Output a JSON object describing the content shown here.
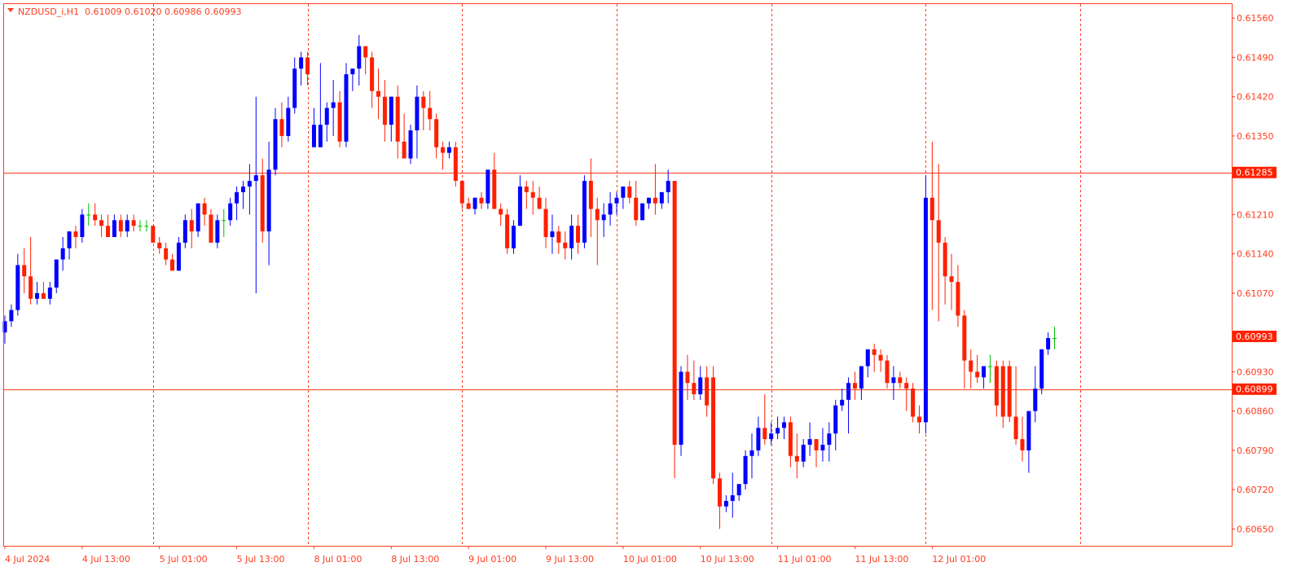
{
  "header": {
    "symbol": "NZDUSD_i,H1",
    "ohlc": "0.61009 0.61020 0.60986 0.60993"
  },
  "colors": {
    "background": "#ffffff",
    "frame": "#ff3c1f",
    "text": "#ff3c1f",
    "bull": "#0000ff",
    "bear": "#ff2000",
    "doji": "#00c000",
    "grid": "#ff3c1f",
    "hline": "#ff3c1f",
    "price_label_bg": "#ff2000",
    "price_label_text": "#ffffff"
  },
  "chart_data": {
    "type": "candlestick",
    "symbol": "NZDUSD_i",
    "timeframe": "H1",
    "ylim": [
      0.6062,
      0.61585
    ],
    "y_ticks": [
      "0.61560",
      "0.61490",
      "0.61420",
      "0.61350",
      "0.61285",
      "0.61210",
      "0.61140",
      "0.61070",
      "0.60993",
      "0.60930",
      "0.60899",
      "0.60860",
      "0.60790",
      "0.60720",
      "0.60650"
    ],
    "x_labels": [
      "4 Jul 2024",
      "4 Jul 13:00",
      "5 Jul 01:00",
      "5 Jul 13:00",
      "8 Jul 01:00",
      "8 Jul 13:00",
      "9 Jul 01:00",
      "9 Jul 13:00",
      "10 Jul 01:00",
      "10 Jul 13:00",
      "11 Jul 01:00",
      "11 Jul 13:00",
      "12 Jul 01:00"
    ],
    "x_label_index": [
      0,
      12,
      24,
      36,
      48,
      60,
      72,
      84,
      96,
      108,
      120,
      132,
      144
    ],
    "vertical_grid_index": [
      23,
      47,
      71,
      95,
      119,
      143,
      167
    ],
    "horizontal_lines": [
      {
        "value": 0.61285,
        "label": "0.61285"
      },
      {
        "value": 0.60899,
        "label": "0.60899"
      }
    ],
    "current_price": {
      "value": 0.60993,
      "label": "0.60993"
    },
    "candles": [
      [
        0.61,
        0.6103,
        0.6098,
        0.6102
      ],
      [
        0.6102,
        0.6105,
        0.6101,
        0.6104
      ],
      [
        0.6104,
        0.6114,
        0.6103,
        0.6112
      ],
      [
        0.6112,
        0.6115,
        0.6107,
        0.611
      ],
      [
        0.611,
        0.6117,
        0.6105,
        0.6106
      ],
      [
        0.6106,
        0.6109,
        0.6105,
        0.6107
      ],
      [
        0.6107,
        0.6109,
        0.6106,
        0.6106
      ],
      [
        0.6106,
        0.6109,
        0.6105,
        0.6108
      ],
      [
        0.6108,
        0.6113,
        0.6107,
        0.6113
      ],
      [
        0.6113,
        0.6117,
        0.6111,
        0.6115
      ],
      [
        0.6115,
        0.6118,
        0.6113,
        0.6118
      ],
      [
        0.6118,
        0.6119,
        0.6115,
        0.6117
      ],
      [
        0.6117,
        0.6122,
        0.6116,
        0.6121
      ],
      [
        0.6121,
        0.6123,
        0.6119,
        0.6121
      ],
      [
        0.6121,
        0.6123,
        0.6119,
        0.612
      ],
      [
        0.612,
        0.6121,
        0.6117,
        0.6119
      ],
      [
        0.6119,
        0.6121,
        0.6117,
        0.6117
      ],
      [
        0.6117,
        0.6121,
        0.6117,
        0.612
      ],
      [
        0.612,
        0.6121,
        0.6117,
        0.6118
      ],
      [
        0.6118,
        0.6121,
        0.6117,
        0.612
      ],
      [
        0.612,
        0.6121,
        0.6118,
        0.6119
      ],
      [
        0.6119,
        0.612,
        0.6118,
        0.6119
      ],
      [
        0.6119,
        0.612,
        0.6118,
        0.6119
      ],
      [
        0.6119,
        0.6119,
        0.6116,
        0.6116
      ],
      [
        0.6116,
        0.6117,
        0.6114,
        0.6115
      ],
      [
        0.6115,
        0.6116,
        0.6112,
        0.6113
      ],
      [
        0.6113,
        0.6114,
        0.6111,
        0.6111
      ],
      [
        0.6111,
        0.6117,
        0.6111,
        0.6116
      ],
      [
        0.6116,
        0.6121,
        0.6115,
        0.612
      ],
      [
        0.612,
        0.6122,
        0.6115,
        0.6118
      ],
      [
        0.6118,
        0.6123,
        0.6117,
        0.6123
      ],
      [
        0.6123,
        0.6124,
        0.6119,
        0.6121
      ],
      [
        0.6121,
        0.6122,
        0.6116,
        0.6116
      ],
      [
        0.6116,
        0.6121,
        0.6115,
        0.612
      ],
      [
        0.612,
        0.6122,
        0.6117,
        0.612
      ],
      [
        0.612,
        0.6124,
        0.6119,
        0.6123
      ],
      [
        0.6123,
        0.6126,
        0.612,
        0.6125
      ],
      [
        0.6125,
        0.6127,
        0.6122,
        0.6126
      ],
      [
        0.6126,
        0.613,
        0.6121,
        0.6127
      ],
      [
        0.6127,
        0.6142,
        0.6107,
        0.6128
      ],
      [
        0.6128,
        0.6131,
        0.6116,
        0.6118
      ],
      [
        0.6118,
        0.6134,
        0.6112,
        0.6129
      ],
      [
        0.6129,
        0.614,
        0.6128,
        0.6138
      ],
      [
        0.6138,
        0.6141,
        0.6133,
        0.6135
      ],
      [
        0.6135,
        0.6142,
        0.6134,
        0.614
      ],
      [
        0.614,
        0.6149,
        0.6139,
        0.6147
      ],
      [
        0.6147,
        0.615,
        0.6144,
        0.6149
      ],
      [
        0.6149,
        0.615,
        0.6144,
        0.6146
      ],
      [
        0.6133,
        0.614,
        0.6133,
        0.6137
      ],
      [
        0.6133,
        0.6148,
        0.6133,
        0.6137
      ],
      [
        0.6137,
        0.6141,
        0.6134,
        0.614
      ],
      [
        0.614,
        0.6145,
        0.6135,
        0.6141
      ],
      [
        0.6141,
        0.6143,
        0.6133,
        0.6134
      ],
      [
        0.6134,
        0.6148,
        0.6133,
        0.6146
      ],
      [
        0.6146,
        0.6147,
        0.6143,
        0.6147
      ],
      [
        0.6147,
        0.6153,
        0.6144,
        0.6151
      ],
      [
        0.6151,
        0.6151,
        0.6146,
        0.6149
      ],
      [
        0.6149,
        0.615,
        0.614,
        0.6143
      ],
      [
        0.6143,
        0.6147,
        0.6138,
        0.6142
      ],
      [
        0.6142,
        0.6145,
        0.6134,
        0.6137
      ],
      [
        0.6137,
        0.6142,
        0.6134,
        0.6142
      ],
      [
        0.6142,
        0.6144,
        0.6131,
        0.6134
      ],
      [
        0.6134,
        0.6139,
        0.6131,
        0.6131
      ],
      [
        0.6131,
        0.6137,
        0.613,
        0.6136
      ],
      [
        0.6136,
        0.6144,
        0.6131,
        0.6142
      ],
      [
        0.6142,
        0.6143,
        0.6136,
        0.614
      ],
      [
        0.614,
        0.6143,
        0.6136,
        0.6138
      ],
      [
        0.6138,
        0.6139,
        0.6131,
        0.6133
      ],
      [
        0.6133,
        0.6134,
        0.6129,
        0.6132
      ],
      [
        0.6132,
        0.6134,
        0.6131,
        0.6133
      ],
      [
        0.6133,
        0.6134,
        0.6126,
        0.6127
      ],
      [
        0.6127,
        0.6127,
        0.6122,
        0.6123
      ],
      [
        0.6123,
        0.6124,
        0.6122,
        0.6122
      ],
      [
        0.6122,
        0.6124,
        0.6121,
        0.6124
      ],
      [
        0.6124,
        0.6125,
        0.6122,
        0.6123
      ],
      [
        0.6123,
        0.6129,
        0.6122,
        0.6129
      ],
      [
        0.6129,
        0.6132,
        0.6125,
        0.6122
      ],
      [
        0.6122,
        0.6123,
        0.6119,
        0.6121
      ],
      [
        0.6121,
        0.6122,
        0.6114,
        0.6115
      ],
      [
        0.6115,
        0.612,
        0.6114,
        0.6119
      ],
      [
        0.6119,
        0.6128,
        0.6119,
        0.6126
      ],
      [
        0.6126,
        0.6127,
        0.6122,
        0.6125
      ],
      [
        0.6125,
        0.6127,
        0.6121,
        0.6124
      ],
      [
        0.6124,
        0.6126,
        0.6122,
        0.6122
      ],
      [
        0.6122,
        0.6124,
        0.6115,
        0.6117
      ],
      [
        0.6117,
        0.6121,
        0.6114,
        0.6118
      ],
      [
        0.6118,
        0.6119,
        0.6114,
        0.6116
      ],
      [
        0.6116,
        0.6118,
        0.6113,
        0.6115
      ],
      [
        0.6115,
        0.6121,
        0.6113,
        0.6119
      ],
      [
        0.6119,
        0.6121,
        0.6114,
        0.6116
      ],
      [
        0.6116,
        0.6128,
        0.6115,
        0.6127
      ],
      [
        0.6127,
        0.6131,
        0.6117,
        0.6122
      ],
      [
        0.6122,
        0.6124,
        0.6112,
        0.612
      ],
      [
        0.612,
        0.6123,
        0.6117,
        0.6121
      ],
      [
        0.6121,
        0.6125,
        0.6119,
        0.6123
      ],
      [
        0.6123,
        0.6125,
        0.6121,
        0.6124
      ],
      [
        0.6124,
        0.6126,
        0.6122,
        0.6126
      ],
      [
        0.6126,
        0.6127,
        0.6123,
        0.6124
      ],
      [
        0.6124,
        0.6127,
        0.6119,
        0.612
      ],
      [
        0.612,
        0.6123,
        0.612,
        0.6123
      ],
      [
        0.6123,
        0.6124,
        0.6122,
        0.6124
      ],
      [
        0.6124,
        0.613,
        0.6121,
        0.6123
      ],
      [
        0.6123,
        0.6125,
        0.6122,
        0.6125
      ],
      [
        0.6125,
        0.6129,
        0.6123,
        0.6127
      ],
      [
        0.6127,
        0.6127,
        0.6074,
        0.608
      ],
      [
        0.608,
        0.6094,
        0.6078,
        0.6093
      ],
      [
        0.6093,
        0.6096,
        0.6088,
        0.6091
      ],
      [
        0.6091,
        0.6095,
        0.6088,
        0.6089
      ],
      [
        0.6089,
        0.6094,
        0.6088,
        0.6092
      ],
      [
        0.6092,
        0.6094,
        0.6085,
        0.6087
      ],
      [
        0.6092,
        0.6094,
        0.6073,
        0.6074
      ],
      [
        0.6074,
        0.6075,
        0.6065,
        0.6069
      ],
      [
        0.6069,
        0.6071,
        0.6068,
        0.607
      ],
      [
        0.607,
        0.6075,
        0.6067,
        0.6071
      ],
      [
        0.6071,
        0.6073,
        0.607,
        0.6073
      ],
      [
        0.6073,
        0.6079,
        0.6072,
        0.6078
      ],
      [
        0.6078,
        0.6082,
        0.6074,
        0.6079
      ],
      [
        0.6079,
        0.6085,
        0.6078,
        0.6083
      ],
      [
        0.6083,
        0.6089,
        0.608,
        0.6081
      ],
      [
        0.6081,
        0.6084,
        0.608,
        0.6082
      ],
      [
        0.6082,
        0.6085,
        0.6081,
        0.6083
      ],
      [
        0.6083,
        0.6085,
        0.6081,
        0.6084
      ],
      [
        0.6084,
        0.6085,
        0.6076,
        0.6078
      ],
      [
        0.6078,
        0.6082,
        0.6074,
        0.6077
      ],
      [
        0.6077,
        0.6081,
        0.6076,
        0.608
      ],
      [
        0.608,
        0.6084,
        0.6078,
        0.6081
      ],
      [
        0.6081,
        0.6081,
        0.6076,
        0.6079
      ],
      [
        0.6079,
        0.6083,
        0.6077,
        0.608
      ],
      [
        0.608,
        0.6084,
        0.6077,
        0.6082
      ],
      [
        0.6082,
        0.6088,
        0.6079,
        0.6087
      ],
      [
        0.6087,
        0.609,
        0.6086,
        0.6088
      ],
      [
        0.6088,
        0.6092,
        0.6082,
        0.6091
      ],
      [
        0.6091,
        0.6093,
        0.6088,
        0.609
      ],
      [
        0.609,
        0.6094,
        0.6088,
        0.6094
      ],
      [
        0.6094,
        0.6097,
        0.6092,
        0.6097
      ],
      [
        0.6097,
        0.6098,
        0.6093,
        0.6096
      ],
      [
        0.6096,
        0.6097,
        0.6093,
        0.6095
      ],
      [
        0.6095,
        0.6096,
        0.609,
        0.6091
      ],
      [
        0.6091,
        0.6094,
        0.6088,
        0.6092
      ],
      [
        0.6092,
        0.6093,
        0.609,
        0.6091
      ],
      [
        0.6091,
        0.6092,
        0.6086,
        0.609
      ],
      [
        0.609,
        0.6091,
        0.6084,
        0.6085
      ],
      [
        0.6085,
        0.6087,
        0.6082,
        0.6084
      ],
      [
        0.6084,
        0.6128,
        0.6082,
        0.6124
      ],
      [
        0.6124,
        0.6134,
        0.6104,
        0.612
      ],
      [
        0.612,
        0.613,
        0.6102,
        0.6116
      ],
      [
        0.6116,
        0.6117,
        0.6105,
        0.611
      ],
      [
        0.611,
        0.6114,
        0.6104,
        0.6109
      ],
      [
        0.6109,
        0.6112,
        0.6101,
        0.6103
      ],
      [
        0.6103,
        0.6104,
        0.609,
        0.6095
      ],
      [
        0.6095,
        0.6097,
        0.609,
        0.6093
      ],
      [
        0.6093,
        0.6096,
        0.6091,
        0.6092
      ],
      [
        0.6092,
        0.6093,
        0.609,
        0.6094
      ],
      [
        0.6094,
        0.6096,
        0.6091,
        0.6094
      ],
      [
        0.6094,
        0.6095,
        0.6085,
        0.6087
      ],
      [
        0.6094,
        0.6095,
        0.6083,
        0.6085
      ],
      [
        0.6094,
        0.6095,
        0.6084,
        0.6085
      ],
      [
        0.6085,
        0.6094,
        0.608,
        0.6081
      ],
      [
        0.6081,
        0.6085,
        0.6077,
        0.6079
      ],
      [
        0.6079,
        0.6086,
        0.6075,
        0.6086
      ],
      [
        0.6086,
        0.6094,
        0.6084,
        0.609
      ],
      [
        0.609,
        0.6097,
        0.6089,
        0.6097
      ],
      [
        0.6097,
        0.61,
        0.6096,
        0.6099
      ],
      [
        0.6099,
        0.6101,
        0.6097,
        0.6099
      ]
    ]
  }
}
